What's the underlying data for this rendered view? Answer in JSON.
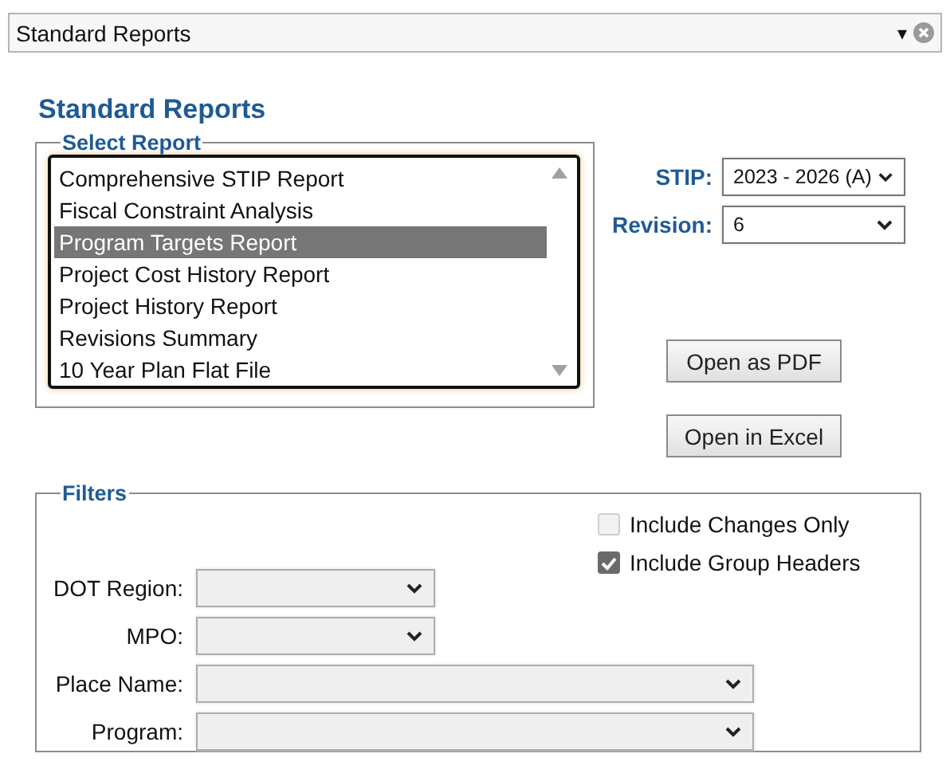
{
  "window": {
    "title": "Standard Reports",
    "menu_glyph": "▾"
  },
  "heading": "Standard Reports",
  "select_report": {
    "legend": "Select Report",
    "items": [
      {
        "label": "Comprehensive STIP Report",
        "selected": false
      },
      {
        "label": "Fiscal Constraint Analysis",
        "selected": false
      },
      {
        "label": "Program Targets Report",
        "selected": true
      },
      {
        "label": "Project Cost History Report",
        "selected": false
      },
      {
        "label": "Project History Report",
        "selected": false
      },
      {
        "label": "Revisions Summary",
        "selected": false
      },
      {
        "label": "10 Year Plan Flat File",
        "selected": false
      }
    ]
  },
  "stip": {
    "label": "STIP:",
    "value": "2023 - 2026 (A)"
  },
  "revision": {
    "label": "Revision:",
    "value": "6"
  },
  "buttons": [
    "Open as PDF",
    "Open in Excel"
  ],
  "filters": {
    "legend": "Filters",
    "checkboxes": [
      {
        "label": "Include Changes Only",
        "checked": false
      },
      {
        "label": "Include Group Headers",
        "checked": true
      }
    ],
    "fields": [
      {
        "label": "DOT Region:",
        "kind": "short"
      },
      {
        "label": "MPO:",
        "kind": "short"
      },
      {
        "label": "Place Name:",
        "kind": "long"
      },
      {
        "label": "Program:",
        "kind": "long"
      }
    ]
  }
}
